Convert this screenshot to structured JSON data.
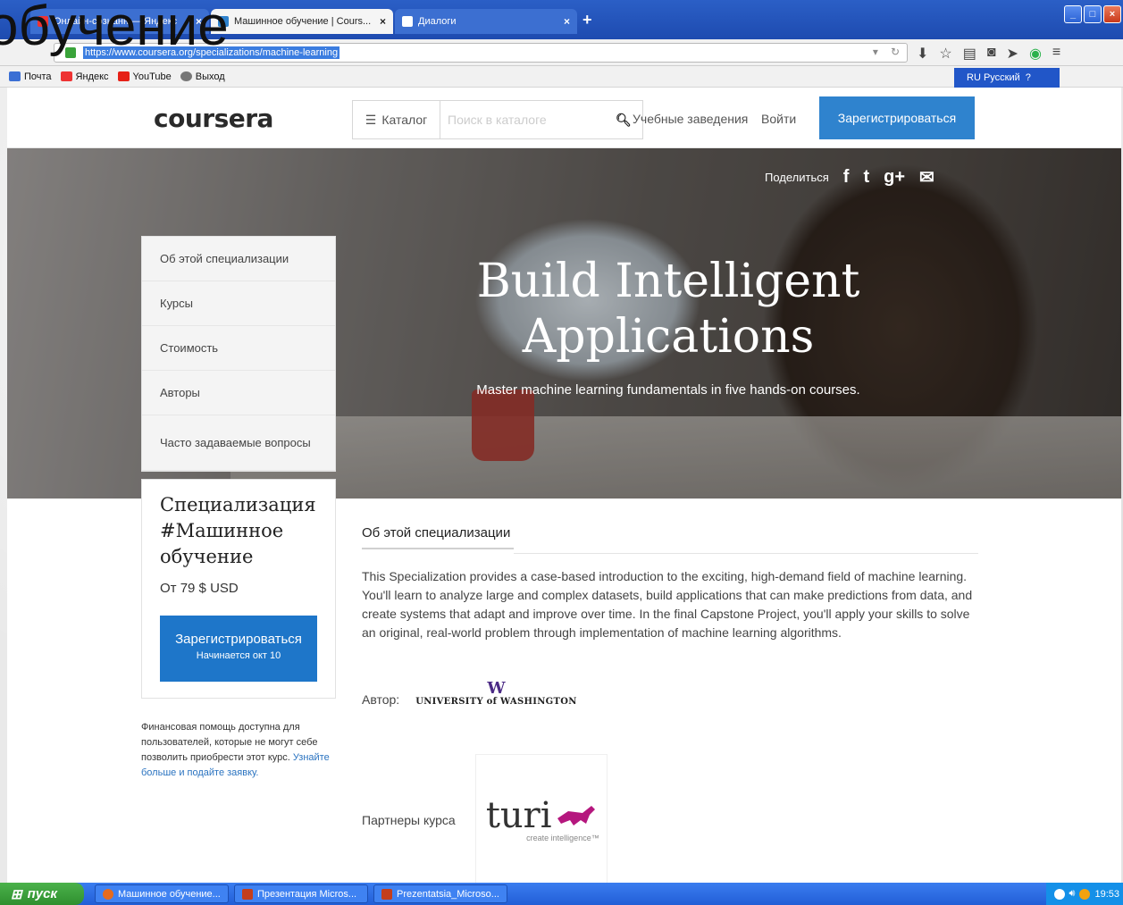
{
  "overlay_text": "обучение",
  "browser": {
    "tabs": [
      {
        "label": "Онлайн-сознанн — Яндекс",
        "close": "×"
      },
      {
        "label": "Машинное обучение | Cours...",
        "close": "×"
      },
      {
        "label": "Диалоги",
        "close": "×"
      }
    ],
    "new_tab": "+",
    "url": "https://www.coursera.org/specializations/machine-learning",
    "window_controls": {
      "minimize": "_",
      "maximize": "□",
      "close": "×"
    },
    "bookmarks": [
      {
        "label": "Почта",
        "icon": "mail-icon",
        "color": "#3b6fd4"
      },
      {
        "label": "Яндекс",
        "icon": "yandex-icon",
        "color": "#e33"
      },
      {
        "label": "YouTube",
        "icon": "youtube-icon",
        "color": "#e62117"
      },
      {
        "label": "Выход",
        "icon": "exit-icon",
        "color": "#777"
      }
    ],
    "language_bar": "RU Русский"
  },
  "coursera": {
    "logo": "coursera",
    "catalog_label": "Каталог",
    "search_placeholder": "Поиск в каталоге",
    "schools_link": "Учебные заведения",
    "login_link": "Войти",
    "signup_button": "Зарегистрироваться",
    "hero": {
      "share_label": "Поделиться",
      "share_icons": [
        "f",
        "t",
        "g+",
        "✉"
      ],
      "title": "Build Intelligent Applications",
      "subtitle": "Master machine learning fundamentals in five hands-on courses."
    },
    "sidenav": [
      "Об этой специализации",
      "Курсы",
      "Стоимость",
      "Авторы",
      "Часто задаваемые вопросы"
    ],
    "spec_card": {
      "title": "Специализация #Машинное обучение",
      "price": "От 79 $ USD",
      "button_main": "Зарегистрироваться",
      "button_sub": "Начинается окт 10"
    },
    "financial_aid": {
      "text": "Финансовая помощь доступна для пользователей, которые не могут себе позволить приобрести этот курс.",
      "link": "Узнайте больше и подайте заявку."
    },
    "about": {
      "tab_label": "Об этой специализации",
      "text": "This Specialization provides a case-based introduction to the exciting, high-demand field of machine learning. You'll learn to analyze large and complex datasets, build applications that can make predictions from data, and create systems that adapt and improve over time. In the final Capstone Project, you'll apply your skills to solve an original, real-world problem through implementation of machine learning algorithms.",
      "author_label": "Автор:",
      "university_mark": "W",
      "university_name": "UNIVERSITY of WASHINGTON",
      "partners_label": "Партнеры курса",
      "partner_word": "turi",
      "partner_tagline": "create intelligence™"
    }
  },
  "taskbar": {
    "start_label": "пуск",
    "tasks": [
      {
        "label": "Машинное обучение...",
        "color": "#e56b1f"
      },
      {
        "label": "Презентация Micros...",
        "color": "#c43e1c"
      },
      {
        "label": "Prezentatsia_Microso...",
        "color": "#c43e1c"
      }
    ],
    "clock": "19:53"
  }
}
